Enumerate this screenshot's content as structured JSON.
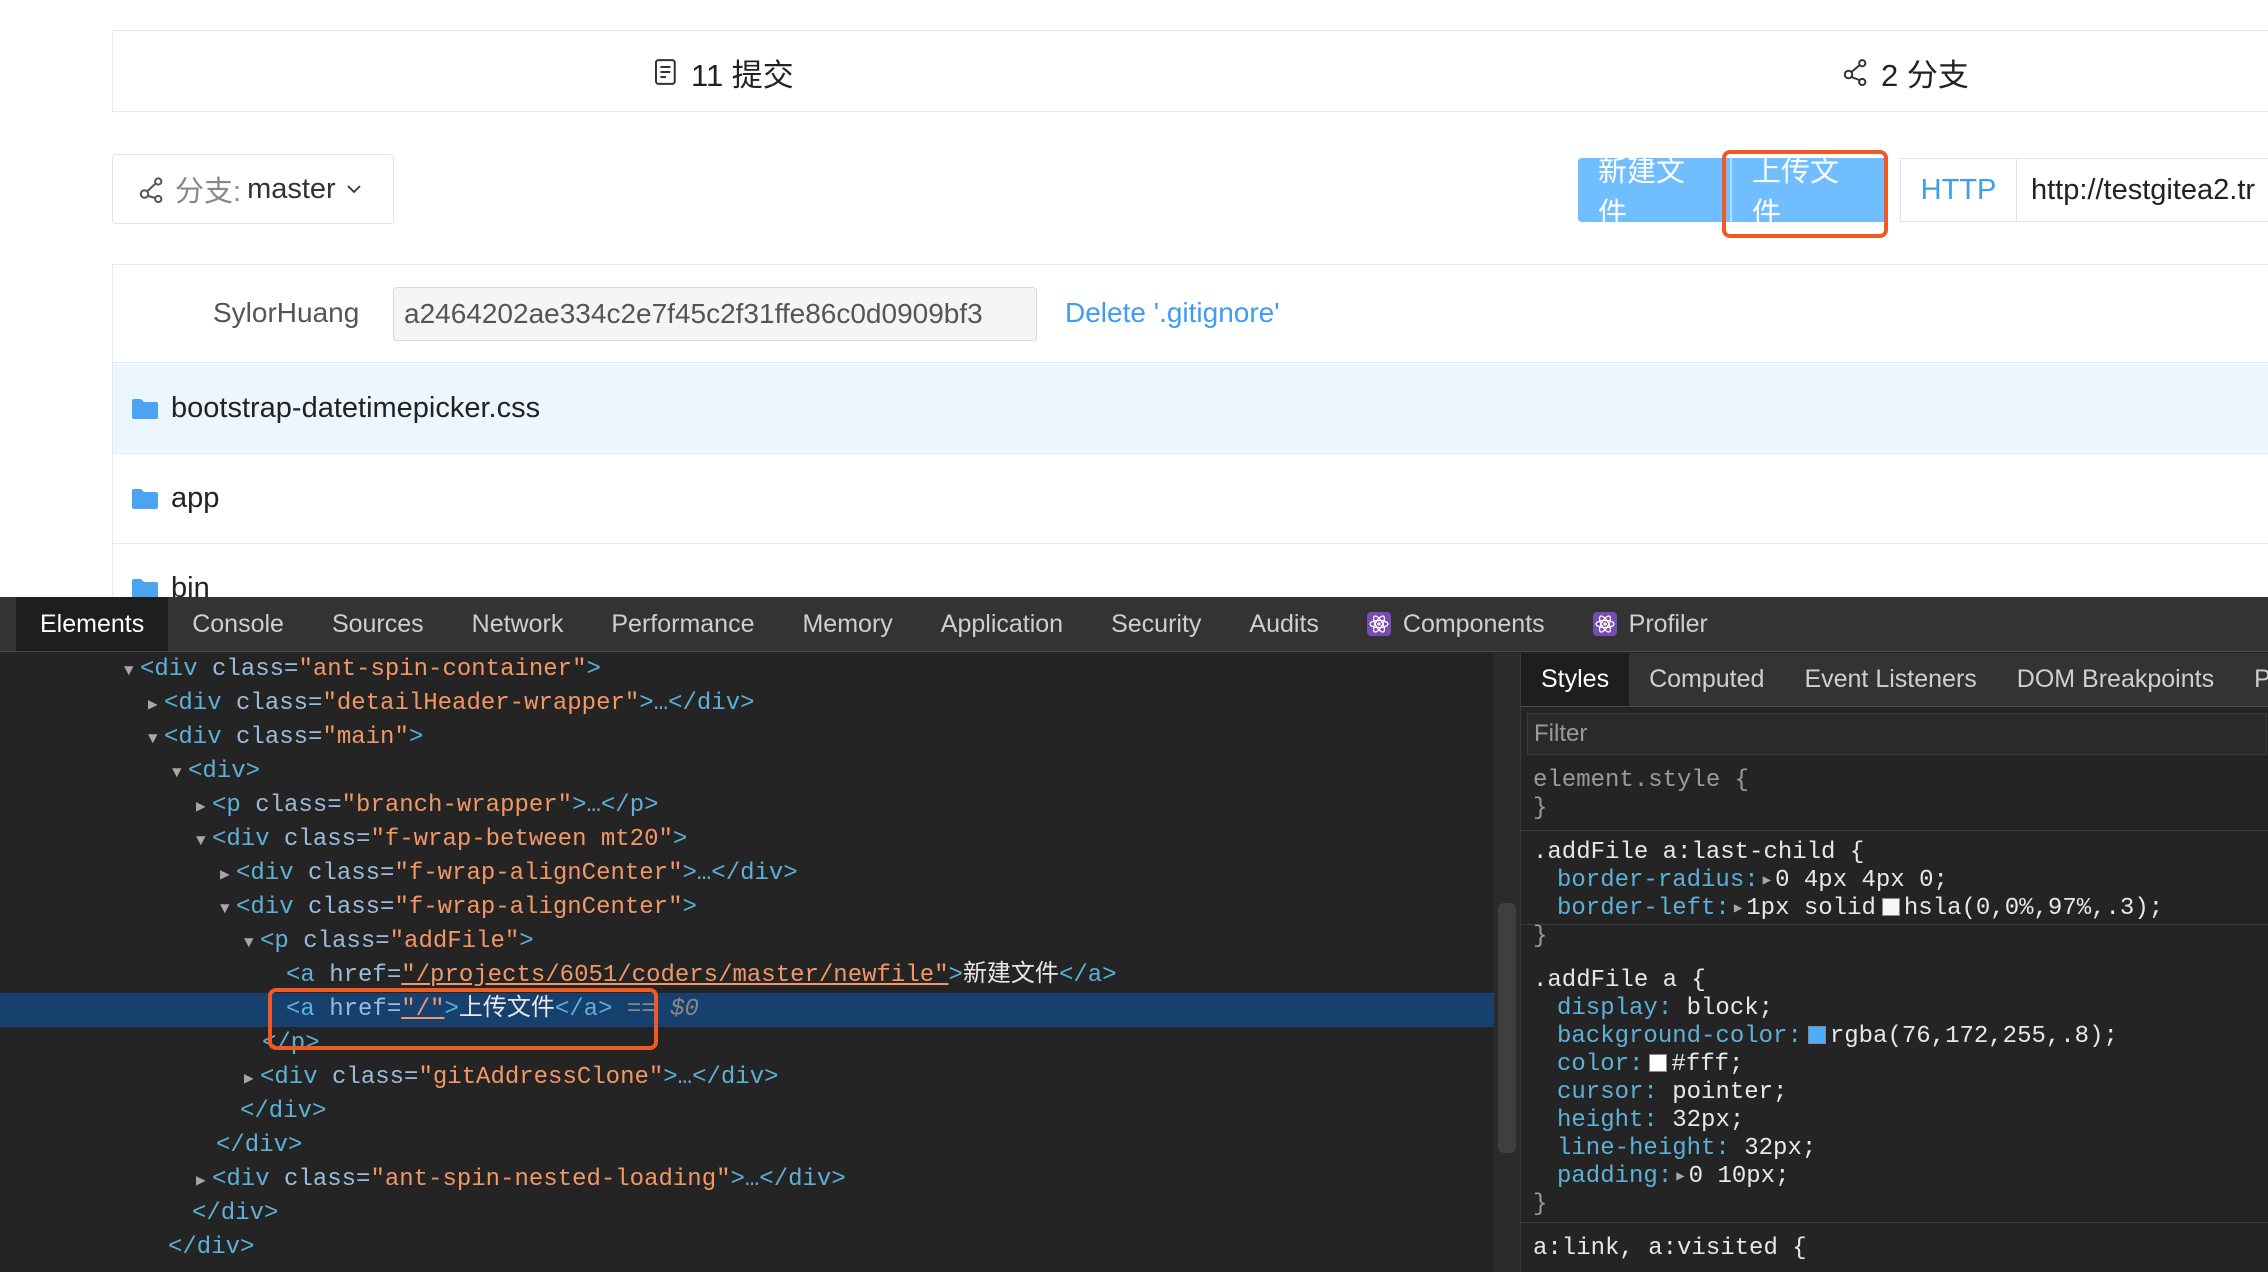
{
  "repo": {
    "commits_label": "11 提交",
    "branches_label": "2 分支"
  },
  "toolbar": {
    "branch_prefix": "分支:",
    "branch_name": "master",
    "new_file_label": "新建文件",
    "upload_file_label": "上传文件",
    "http_label": "HTTP",
    "clone_url": "http://testgitea2.tr"
  },
  "latest_commit": {
    "author": "SylorHuang",
    "sha": "a2464202ae334c2e7f45c2f31ffe86c0d0909bf3",
    "message": "Delete '.gitignore'"
  },
  "files": [
    {
      "name": "bootstrap-datetimepicker.css",
      "icon": "folder-icon"
    },
    {
      "name": "app",
      "icon": "folder-icon"
    },
    {
      "name": "bin",
      "icon": "folder-icon"
    }
  ],
  "devtools": {
    "tabs": [
      "Elements",
      "Console",
      "Sources",
      "Network",
      "Performance",
      "Memory",
      "Application",
      "Security",
      "Audits",
      "Components",
      "Profiler"
    ],
    "styles_tabs": [
      "Styles",
      "Computed",
      "Event Listeners",
      "DOM Breakpoints",
      "Pro"
    ],
    "filter_placeholder": "Filter",
    "dom": {
      "l1": {
        "tag": "<div",
        "attr": " class=",
        "val": "\"ant-spin-container\"",
        "end": ">"
      },
      "l2": {
        "tag": "<div",
        "attr": " class=",
        "val": "\"detailHeader-wrapper\"",
        "end": ">…</div>"
      },
      "l3": {
        "tag": "<div",
        "attr": " class=",
        "val": "\"main\"",
        "end": ">"
      },
      "l4": {
        "tag": "<div>"
      },
      "l5": {
        "tag": "<p",
        "attr": " class=",
        "val": "\"branch-wrapper\"",
        "end": ">…</p>"
      },
      "l6": {
        "tag": "<div",
        "attr": " class=",
        "val": "\"f-wrap-between mt20\"",
        "end": ">"
      },
      "l7": {
        "tag": "<div",
        "attr": " class=",
        "val": "\"f-wrap-alignCenter\"",
        "end": ">…</div>"
      },
      "l8": {
        "tag": "<div",
        "attr": " class=",
        "val": "\"f-wrap-alignCenter\"",
        "end": ">"
      },
      "l9": {
        "tag": "<p",
        "attr": " class=",
        "val": "\"addFile\"",
        "end": ">"
      },
      "l10": {
        "tag": "<a",
        "attr": " href=",
        "val": "\"/projects/6051/coders/master/newfile\"",
        "end": ">",
        "text": "新建文件",
        "close": "</a>"
      },
      "l11": {
        "tag": "<a",
        "attr": " href=",
        "val": "\"/\"",
        "end": ">",
        "text": "上传文件",
        "close": "</a>",
        "marker": " == $0"
      },
      "l12": {
        "tag": "</p>"
      },
      "l13": {
        "tag": "<div",
        "attr": " class=",
        "val": "\"gitAddressClone\"",
        "end": ">…</div>"
      },
      "l14": {
        "tag": "</div>"
      },
      "l15": {
        "tag": "</div>"
      },
      "l16": {
        "tag": "<div",
        "attr": " class=",
        "val": "\"ant-spin-nested-loading\"",
        "end": ">…</div>"
      },
      "l17": {
        "tag": "</div>"
      },
      "l18": {
        "tag": "</div>"
      }
    },
    "styles": {
      "r0_sel": "element.style {",
      "r0_close": "}",
      "r1_sel": ".addFile a:last-child {",
      "r1_p1n": "border-radius:",
      "r1_p1v": "0 4px 4px 0;",
      "r1_p2n": "border-left:",
      "r1_p2v": "1px solid",
      "r1_p2c": "hsla(0,0%,97%,.3);",
      "r1_close": "}",
      "r2_sel": ".addFile a {",
      "r2_p1n": "display:",
      "r2_p1v": "block;",
      "r2_p2n": "background-color:",
      "r2_p2v": "rgba(76,172,255,.8);",
      "r2_p3n": "color:",
      "r2_p3v": "#fff;",
      "r2_p4n": "cursor:",
      "r2_p4v": "pointer;",
      "r2_p5n": "height:",
      "r2_p5v": "32px;",
      "r2_p6n": "line-height:",
      "r2_p6v": "32px;",
      "r2_p7n": "padding:",
      "r2_p7v": "0 10px;",
      "r2_close": "}",
      "r3_sel": "a:link, a:visited {"
    }
  },
  "colors": {
    "accent_blue": "#4cacff",
    "highlight_orange": "#ee5a24",
    "devtools_bg": "#242424",
    "dom_selected": "#16406e"
  }
}
